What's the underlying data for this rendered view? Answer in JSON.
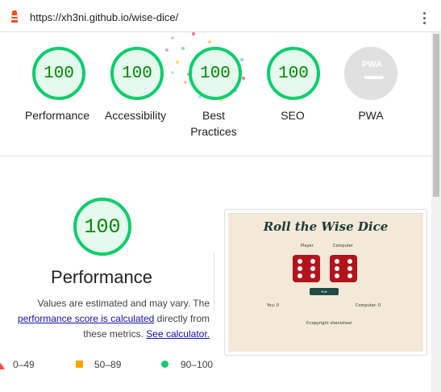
{
  "browser": {
    "url": "https://xh3ni.github.io/wise-dice/"
  },
  "categories": [
    {
      "score": "100",
      "label": "Performance"
    },
    {
      "score": "100",
      "label": "Accessibility"
    },
    {
      "score": "100",
      "label": "Best Practices"
    },
    {
      "score": "100",
      "label": "SEO"
    },
    {
      "label": "PWA",
      "badge": "PWA"
    }
  ],
  "performance": {
    "score": "100",
    "title": "Performance",
    "desc_part1": "Values are estimated and may vary. The",
    "desc_link1": "performance score is calculated",
    "desc_part2": "directly from these metrics.",
    "desc_link2": "See calculator."
  },
  "legend": {
    "fail": "0–49",
    "average": "50–89",
    "pass": "90–100"
  },
  "thumbnail": {
    "title": "Roll the Wise Dice",
    "player_label": "Player",
    "computer_label": "Computer",
    "button": "Roll",
    "you_score": "You: 0",
    "computer_score": "Computer: 0",
    "footer": "©copyright xhenixhexi"
  },
  "colors": {
    "pass": "#0cce6b",
    "average": "#ffa400",
    "fail": "#ff4e42",
    "score_text": "#008800",
    "dice": "#b3141b",
    "thumb_bg": "#f3e9d8"
  }
}
